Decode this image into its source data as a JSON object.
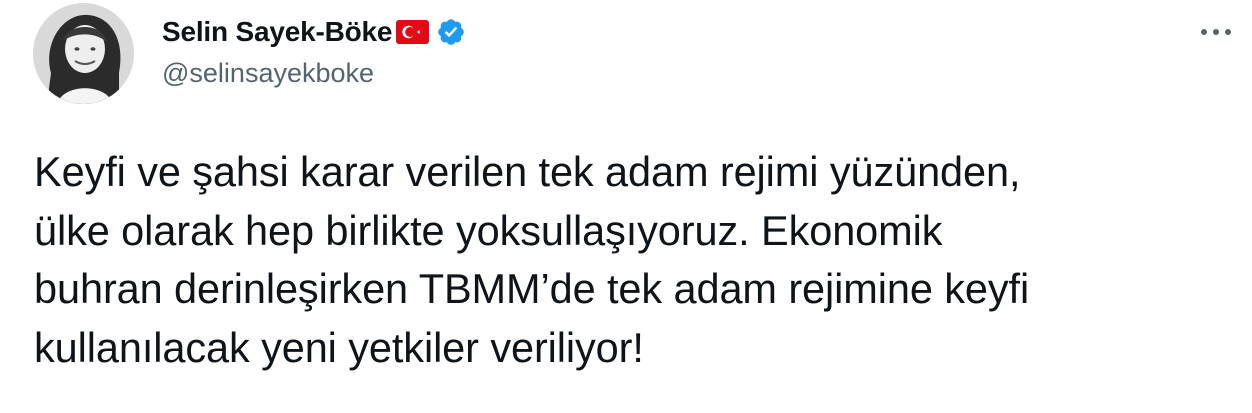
{
  "author": {
    "display_name": "Selin Sayek-Böke",
    "handle": "@selinsayekboke",
    "flag_icon": "turkey-flag-icon",
    "verified_icon": "verified-badge-icon",
    "verified_color": "#1d9bf0"
  },
  "tweet": {
    "text": "Keyfi ve şahsi karar verilen tek adam rejimi yüzünden,\nülke olarak hep birlikte yoksullaşıyoruz. Ekonomik\nbuhran derinleşirken TBMM’de tek adam rejimine keyfi\nkullanılacak yeni yetkiler veriliyor!"
  },
  "actions": {
    "more_icon": "more-options-icon"
  },
  "colors": {
    "text": "#0f1419",
    "secondary_text": "#536471",
    "flag_red": "#e30a17"
  }
}
